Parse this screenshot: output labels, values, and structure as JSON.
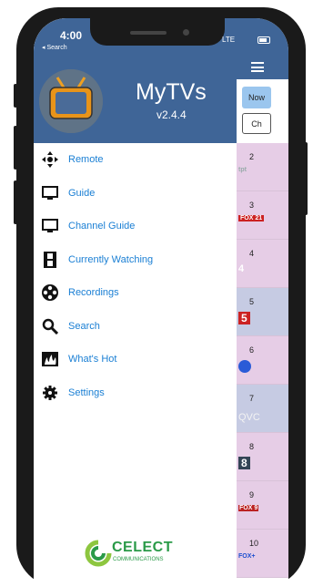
{
  "status": {
    "time": "4:00",
    "back": "◂ Search",
    "network": "LTE"
  },
  "app": {
    "title": "MyTVs",
    "version": "v2.4.4"
  },
  "menu": [
    {
      "label": "Remote",
      "icon": "move-arrows-icon"
    },
    {
      "label": "Guide",
      "icon": "tv-icon"
    },
    {
      "label": "Channel Guide",
      "icon": "tv-icon"
    },
    {
      "label": "Currently Watching",
      "icon": "film-strip-icon"
    },
    {
      "label": "Recordings",
      "icon": "film-reel-icon"
    },
    {
      "label": "Search",
      "icon": "magnifier-icon"
    },
    {
      "label": "What's Hot",
      "icon": "flames-icon"
    },
    {
      "label": "Settings",
      "icon": "gear-icon"
    }
  ],
  "brand": {
    "name": "CELECT",
    "sub": "COMMUNICATIONS",
    "color": "#2a9a48"
  },
  "controls": {
    "now": "Now",
    "ch": "Ch"
  },
  "channels": [
    {
      "number": "2",
      "logo": "tpt"
    },
    {
      "number": "3",
      "logo": "FOX 21"
    },
    {
      "number": "4",
      "logo": "4"
    },
    {
      "number": "5",
      "logo": "5"
    },
    {
      "number": "6",
      "logo": ""
    },
    {
      "number": "7",
      "logo": "QVC"
    },
    {
      "number": "8",
      "logo": "8"
    },
    {
      "number": "9",
      "logo": "FOX 9"
    },
    {
      "number": "10",
      "logo": "FOX+"
    }
  ],
  "colors": {
    "header": "#3f6597",
    "menu_text": "#1a7fd4",
    "channel_bg": "#e6cde6",
    "channel_alt": "#c6cbe3"
  }
}
